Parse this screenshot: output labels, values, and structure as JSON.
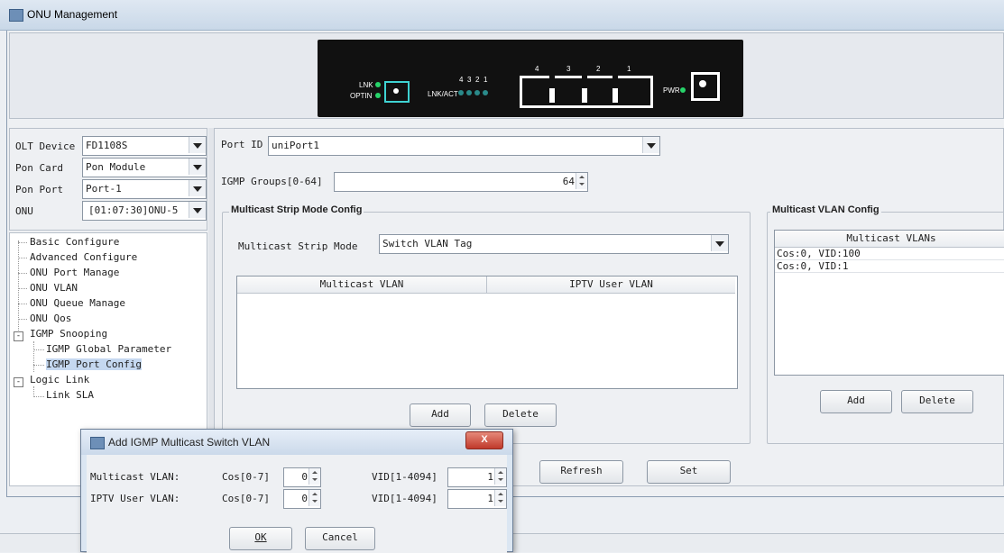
{
  "window": {
    "title": "ONU Management"
  },
  "device_panel": {
    "labels": {
      "lnk": "LNK",
      "optin": "OPTIN",
      "lnkact": "LNK/ACT",
      "pwr": "PWR"
    },
    "small_ports": [
      "4",
      "3",
      "2",
      "1"
    ],
    "big_ports": [
      "4",
      "3",
      "2",
      "1"
    ]
  },
  "selectors": [
    {
      "label": "OLT Device",
      "value": "FD1108S"
    },
    {
      "label": "Pon Card",
      "value": "Pon Module"
    },
    {
      "label": "Pon Port",
      "value": "Port-1"
    },
    {
      "label": "ONU",
      "value": "[01:07:30]ONU-5"
    }
  ],
  "tree": [
    "Basic Configure",
    "Advanced Configure",
    "ONU Port Manage",
    "ONU VLAN",
    "ONU Queue Manage",
    "ONU Qos",
    "IGMP Snooping",
    "IGMP Global Parameter",
    "IGMP Port Config",
    "Logic Link",
    "Link SLA"
  ],
  "tree_toggles": {
    "igmp": "-",
    "logic": "-"
  },
  "port": {
    "label": "Port ID",
    "value": "uniPort1"
  },
  "igmp_groups": {
    "label": "IGMP Groups[0-64]",
    "value": "64"
  },
  "strip": {
    "title": "Multicast Strip Mode Config",
    "mode_label": "Multicast Strip  Mode",
    "mode_value": "Switch VLAN Tag",
    "columns": [
      "Multicast VLAN",
      "IPTV User VLAN"
    ],
    "add": "Add",
    "delete": "Delete"
  },
  "mvlan": {
    "title": "Multicast VLAN Config",
    "column": "Multicast VLANs",
    "rows": [
      "Cos:0, VID:100",
      "Cos:0, VID:1"
    ],
    "add": "Add",
    "delete": "Delete"
  },
  "actions": {
    "refresh": "Refresh",
    "set": "Set"
  },
  "dialog": {
    "title": "Add IGMP Multicast Switch VLAN",
    "close": "X",
    "row1": {
      "label": "Multicast VLAN:",
      "cos_label": "Cos[0-7]",
      "cos": "0",
      "vid_label": "VID[1-4094]",
      "vid": "1"
    },
    "row2": {
      "label": "IPTV User VLAN:",
      "cos_label": "Cos[0-7]",
      "cos": "0",
      "vid_label": "VID[1-4094]",
      "vid": "1"
    },
    "ok": "OK",
    "cancel": "Cancel"
  }
}
